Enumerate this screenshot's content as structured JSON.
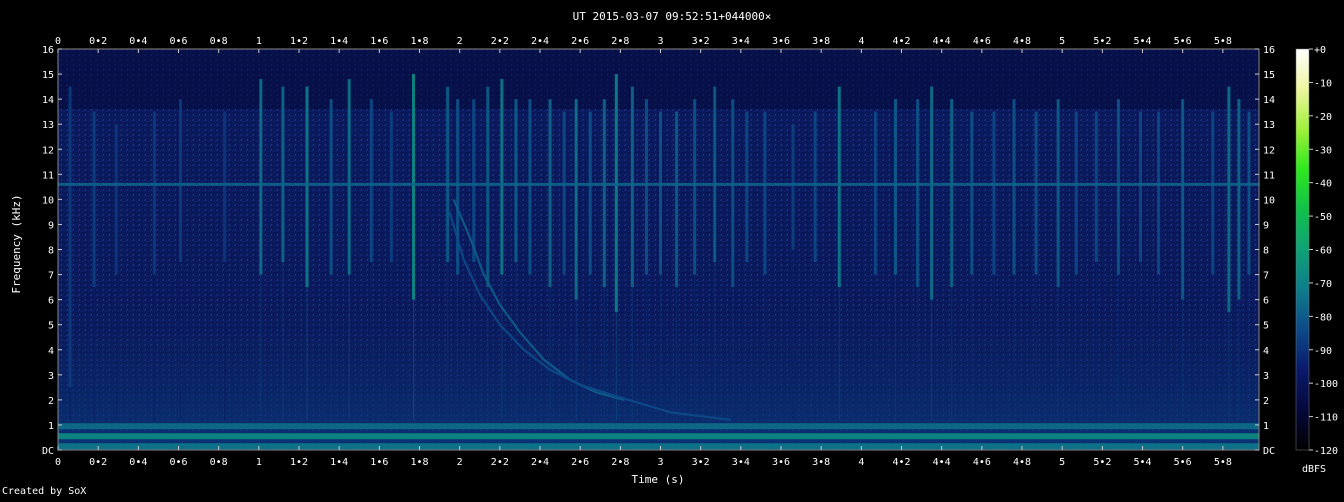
{
  "chart_data": {
    "type": "heatmap",
    "title": "UT 2015-03-07 09:52:51+044000×",
    "xlabel": "Time (s)",
    "ylabel": "Frequency (kHz)",
    "xlim": [
      0,
      5.98
    ],
    "ylim": [
      0,
      16
    ],
    "x_ticks": [
      "0",
      "0•2",
      "0•4",
      "0•6",
      "0•8",
      "1",
      "1•2",
      "1•4",
      "1•6",
      "1•8",
      "2",
      "2•2",
      "2•4",
      "2•6",
      "2•8",
      "3",
      "3•2",
      "3•4",
      "3•6",
      "3•8",
      "4",
      "4•2",
      "4•4",
      "4•6",
      "4•8",
      "5",
      "5•2",
      "5•4",
      "5•6",
      "5•8"
    ],
    "y_ticks": [
      "DC",
      "1",
      "2",
      "3",
      "4",
      "5",
      "6",
      "7",
      "8",
      "9",
      "10",
      "11",
      "12",
      "13",
      "14",
      "15",
      "16"
    ],
    "colorbar": {
      "label": "dBFS",
      "ticks": [
        "+0",
        "-10",
        "-20",
        "-30",
        "-40",
        "-50",
        "-60",
        "-70",
        "-80",
        "-90",
        "-100",
        "-110",
        "-120"
      ],
      "range": [
        -120,
        0
      ]
    },
    "grid": false,
    "features": {
      "background_level_dbfs": -98,
      "horizontal_tone": {
        "freq_khz": 10.6,
        "level_dbfs": -85
      },
      "low_band": [
        {
          "freq_khz": 0.15,
          "level_dbfs": -80
        },
        {
          "freq_khz": 0.55,
          "level_dbfs": -75
        },
        {
          "freq_khz": 0.95,
          "level_dbfs": -82
        }
      ],
      "impulses": [
        {
          "t": 0.06,
          "top": 14.5,
          "bottom": 2.5,
          "level_dbfs": -93
        },
        {
          "t": 0.18,
          "top": 13.5,
          "bottom": 6.5,
          "level_dbfs": -92
        },
        {
          "t": 0.29,
          "top": 13.0,
          "bottom": 7.0,
          "level_dbfs": -94
        },
        {
          "t": 0.48,
          "top": 13.5,
          "bottom": 7.0,
          "level_dbfs": -93
        },
        {
          "t": 0.61,
          "top": 14.0,
          "bottom": 7.5,
          "level_dbfs": -93
        },
        {
          "t": 0.83,
          "top": 13.5,
          "bottom": 7.5,
          "level_dbfs": -94
        },
        {
          "t": 1.01,
          "top": 14.8,
          "bottom": 7.0,
          "level_dbfs": -82
        },
        {
          "t": 1.12,
          "top": 14.5,
          "bottom": 7.5,
          "level_dbfs": -84
        },
        {
          "t": 1.24,
          "top": 14.5,
          "bottom": 6.5,
          "level_dbfs": -80
        },
        {
          "t": 1.36,
          "top": 14.0,
          "bottom": 7.0,
          "level_dbfs": -88
        },
        {
          "t": 1.45,
          "top": 14.8,
          "bottom": 7.0,
          "level_dbfs": -82
        },
        {
          "t": 1.56,
          "top": 14.0,
          "bottom": 7.5,
          "level_dbfs": -90
        },
        {
          "t": 1.66,
          "top": 13.5,
          "bottom": 7.5,
          "level_dbfs": -92
        },
        {
          "t": 1.77,
          "top": 15.0,
          "bottom": 6.0,
          "level_dbfs": -76
        },
        {
          "t": 1.94,
          "top": 14.5,
          "bottom": 7.5,
          "level_dbfs": -86
        },
        {
          "t": 1.99,
          "top": 14.0,
          "bottom": 7.0,
          "level_dbfs": -88
        },
        {
          "t": 2.07,
          "top": 14.0,
          "bottom": 7.5,
          "level_dbfs": -90
        },
        {
          "t": 2.14,
          "top": 14.5,
          "bottom": 6.5,
          "level_dbfs": -86
        },
        {
          "t": 2.21,
          "top": 14.8,
          "bottom": 7.0,
          "level_dbfs": -80
        },
        {
          "t": 2.28,
          "top": 14.0,
          "bottom": 7.5,
          "level_dbfs": -86
        },
        {
          "t": 2.35,
          "top": 14.0,
          "bottom": 7.0,
          "level_dbfs": -88
        },
        {
          "t": 2.45,
          "top": 14.0,
          "bottom": 6.5,
          "level_dbfs": -84
        },
        {
          "t": 2.52,
          "top": 13.5,
          "bottom": 7.0,
          "level_dbfs": -90
        },
        {
          "t": 2.58,
          "top": 14.0,
          "bottom": 6.0,
          "level_dbfs": -82
        },
        {
          "t": 2.65,
          "top": 13.5,
          "bottom": 7.0,
          "level_dbfs": -88
        },
        {
          "t": 2.72,
          "top": 14.0,
          "bottom": 6.5,
          "level_dbfs": -84
        },
        {
          "t": 2.78,
          "top": 15.0,
          "bottom": 5.5,
          "level_dbfs": -78
        },
        {
          "t": 2.86,
          "top": 14.5,
          "bottom": 6.5,
          "level_dbfs": -84
        },
        {
          "t": 2.93,
          "top": 14.0,
          "bottom": 7.0,
          "level_dbfs": -88
        },
        {
          "t": 3.0,
          "top": 13.5,
          "bottom": 7.0,
          "level_dbfs": -88
        },
        {
          "t": 3.08,
          "top": 13.5,
          "bottom": 6.5,
          "level_dbfs": -86
        },
        {
          "t": 3.17,
          "top": 14.0,
          "bottom": 7.0,
          "level_dbfs": -88
        },
        {
          "t": 3.27,
          "top": 14.5,
          "bottom": 7.5,
          "level_dbfs": -86
        },
        {
          "t": 3.36,
          "top": 14.0,
          "bottom": 6.5,
          "level_dbfs": -88
        },
        {
          "t": 3.43,
          "top": 13.5,
          "bottom": 7.5,
          "level_dbfs": -90
        },
        {
          "t": 3.52,
          "top": 13.5,
          "bottom": 7.0,
          "level_dbfs": -90
        },
        {
          "t": 3.66,
          "top": 13.0,
          "bottom": 8.0,
          "level_dbfs": -92
        },
        {
          "t": 3.77,
          "top": 13.5,
          "bottom": 7.5,
          "level_dbfs": -90
        },
        {
          "t": 3.89,
          "top": 14.5,
          "bottom": 6.5,
          "level_dbfs": -80
        },
        {
          "t": 4.07,
          "top": 13.5,
          "bottom": 7.0,
          "level_dbfs": -90
        },
        {
          "t": 4.17,
          "top": 14.0,
          "bottom": 7.0,
          "level_dbfs": -86
        },
        {
          "t": 4.28,
          "top": 14.0,
          "bottom": 6.5,
          "level_dbfs": -88
        },
        {
          "t": 4.35,
          "top": 14.5,
          "bottom": 6.0,
          "level_dbfs": -82
        },
        {
          "t": 4.45,
          "top": 14.0,
          "bottom": 6.5,
          "level_dbfs": -84
        },
        {
          "t": 4.55,
          "top": 13.5,
          "bottom": 7.0,
          "level_dbfs": -88
        },
        {
          "t": 4.66,
          "top": 13.5,
          "bottom": 7.0,
          "level_dbfs": -90
        },
        {
          "t": 4.76,
          "top": 14.0,
          "bottom": 7.0,
          "level_dbfs": -88
        },
        {
          "t": 4.87,
          "top": 13.5,
          "bottom": 7.0,
          "level_dbfs": -88
        },
        {
          "t": 4.98,
          "top": 14.0,
          "bottom": 6.5,
          "level_dbfs": -86
        },
        {
          "t": 5.07,
          "top": 13.5,
          "bottom": 7.0,
          "level_dbfs": -90
        },
        {
          "t": 5.17,
          "top": 13.5,
          "bottom": 7.5,
          "level_dbfs": -90
        },
        {
          "t": 5.28,
          "top": 14.0,
          "bottom": 7.0,
          "level_dbfs": -88
        },
        {
          "t": 5.39,
          "top": 13.5,
          "bottom": 7.5,
          "level_dbfs": -90
        },
        {
          "t": 5.48,
          "top": 13.5,
          "bottom": 7.0,
          "level_dbfs": -90
        },
        {
          "t": 5.6,
          "top": 14.0,
          "bottom": 6.0,
          "level_dbfs": -86
        },
        {
          "t": 5.75,
          "top": 13.5,
          "bottom": 7.0,
          "level_dbfs": -90
        },
        {
          "t": 5.83,
          "top": 14.5,
          "bottom": 5.5,
          "level_dbfs": -82
        },
        {
          "t": 5.88,
          "top": 14.0,
          "bottom": 6.0,
          "level_dbfs": -84
        },
        {
          "t": 5.93,
          "top": 13.5,
          "bottom": 7.0,
          "level_dbfs": -88
        }
      ],
      "sweeps": [
        {
          "level_dbfs": -86,
          "points": [
            [
              1.97,
              10.0
            ],
            [
              2.05,
              8.5
            ],
            [
              2.12,
              7.0
            ],
            [
              2.2,
              5.8
            ],
            [
              2.3,
              4.7
            ],
            [
              2.42,
              3.6
            ],
            [
              2.55,
              2.8
            ],
            [
              2.68,
              2.3
            ],
            [
              2.82,
              2.0
            ]
          ]
        },
        {
          "level_dbfs": -90,
          "points": [
            [
              1.95,
              9.5
            ],
            [
              2.02,
              7.6
            ],
            [
              2.1,
              6.2
            ],
            [
              2.2,
              5.0
            ],
            [
              2.32,
              4.0
            ],
            [
              2.45,
              3.2
            ],
            [
              2.6,
              2.6
            ],
            [
              2.8,
              2.1
            ],
            [
              3.05,
              1.5
            ],
            [
              3.35,
              1.2
            ]
          ]
        }
      ]
    }
  },
  "footer": {
    "credit": "Created by SoX"
  }
}
